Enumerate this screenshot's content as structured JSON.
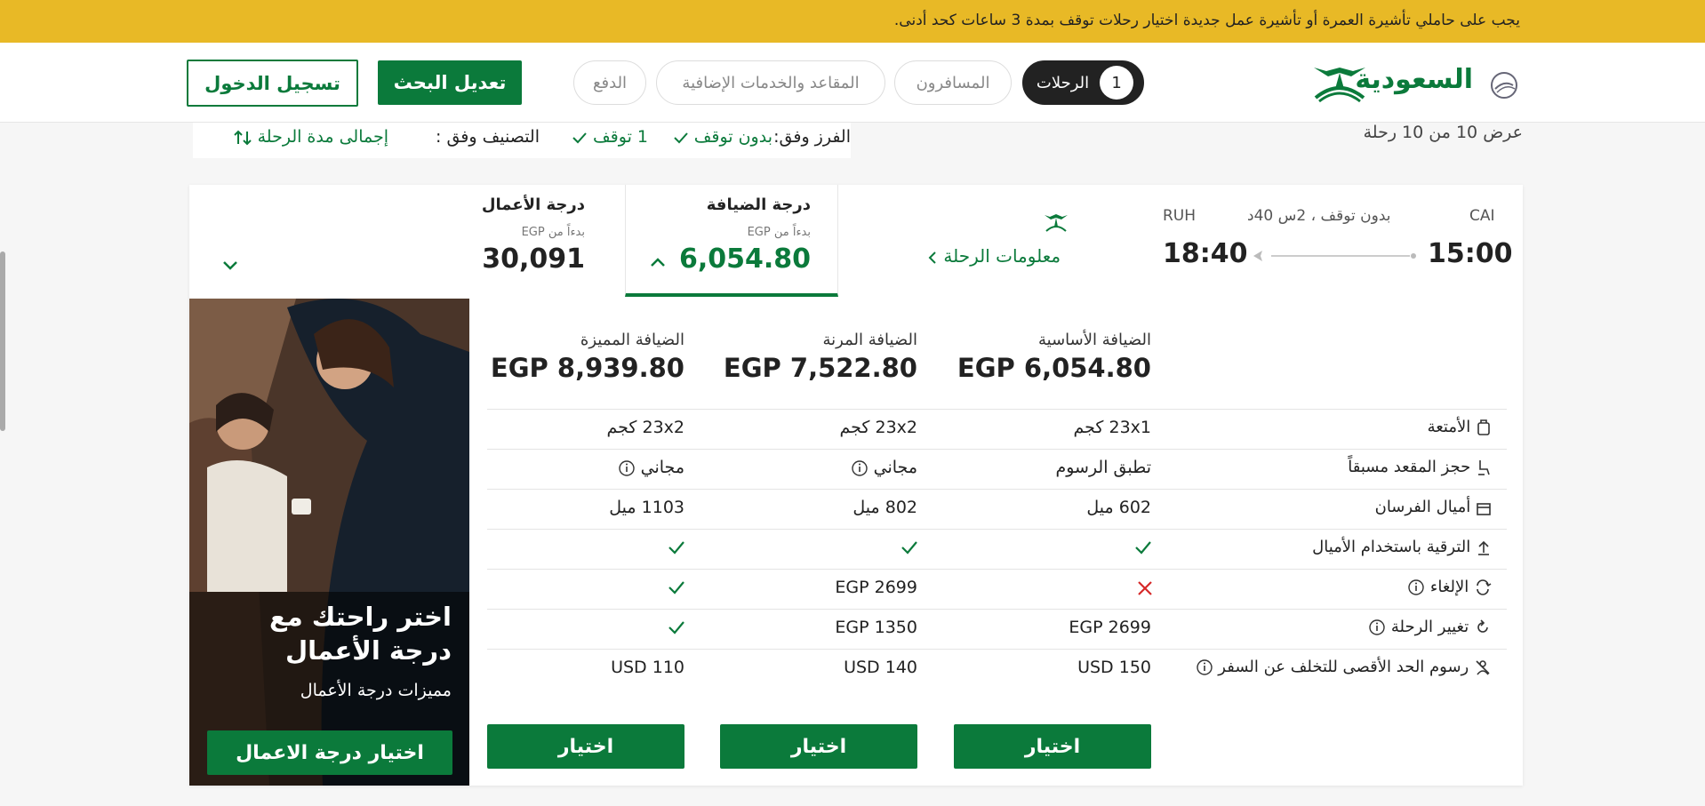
{
  "banner": {
    "text": "يجب على حاملي تأشيرة العمرة أو تأشيرة عمل جديدة اختيار رحلات توقف بمدة 3 ساعات كحد أدنى."
  },
  "header": {
    "logo_text": "السعودية",
    "steps": [
      {
        "num": "1",
        "label": "الرحلات",
        "active": true
      },
      {
        "label": "المسافرون"
      },
      {
        "label": "المقاعد والخدمات الإضافية"
      },
      {
        "label": "الدفع"
      }
    ],
    "modify_search": "تعديل البحث",
    "login": "تسجيل الدخول"
  },
  "filters": {
    "results_count": "عرض 10 من 10 رحلة",
    "filter_by": "الفرز وفق:",
    "nonstop": "بدون توقف",
    "one_stop": "1 توقف",
    "sort_by": "التصنيف وفق :",
    "sort_value": "إجمالى مدة الرحلة"
  },
  "flight": {
    "origin": "CAI",
    "destination": "RUH",
    "depart_time": "15:00",
    "arrive_time": "18:40",
    "stops_duration": "بدون توقف ، 2س 40د",
    "flight_info": "معلومات الرحلة"
  },
  "fare_tabs": {
    "guest": {
      "title": "درجة الضيافة",
      "from": "بدءاً من EGP",
      "price": "6,054.80"
    },
    "business": {
      "title": "درجة الأعمال",
      "from": "بدءاً من EGP",
      "price": "30,091"
    }
  },
  "fare_columns": [
    {
      "name": "الضيافة الأساسية",
      "price": "EGP 6,054.80",
      "baggage": "23x1 كجم",
      "seat": "تطبق الرسوم",
      "miles": "602 ميل",
      "upgrade": "check",
      "cancel": "x",
      "change": "EGP 2699",
      "noshow": "USD 150",
      "select": "اختيار"
    },
    {
      "name": "الضيافة المرنة",
      "price": "EGP 7,522.80",
      "baggage": "23x2 كجم",
      "seat": "مجاني",
      "miles": "802 ميل",
      "upgrade": "check",
      "cancel": "EGP 2699",
      "change": "EGP 1350",
      "noshow": "USD 140",
      "select": "اختيار"
    },
    {
      "name": "الضيافة المميزة",
      "price": "EGP 8,939.80",
      "baggage": "23x2 كجم",
      "seat": "مجاني",
      "miles": "1103 ميل",
      "upgrade": "check",
      "cancel": "check",
      "change": "check",
      "noshow": "USD 110",
      "select": "اختيار"
    }
  ],
  "row_labels": {
    "baggage": "الأمتعة",
    "seat": "حجز المقعد مسبقاً",
    "miles": "أميال الفرسان",
    "upgrade": "الترقية باستخدام الأميال",
    "cancel": "الإلغاء",
    "change": "تغيير الرحلة",
    "noshow": "رسوم الحد الأقصى للتخلف عن السفر"
  },
  "promo": {
    "headline": "اختر راحتك مع درجة الأعمال",
    "subtitle": "مميزات درجة الأعمال",
    "button": "اختيار درجة الاعمال"
  },
  "colors": {
    "brand_green": "#0b7a3b",
    "banner_yellow": "#e8b926",
    "cancel_red": "#d62828"
  }
}
